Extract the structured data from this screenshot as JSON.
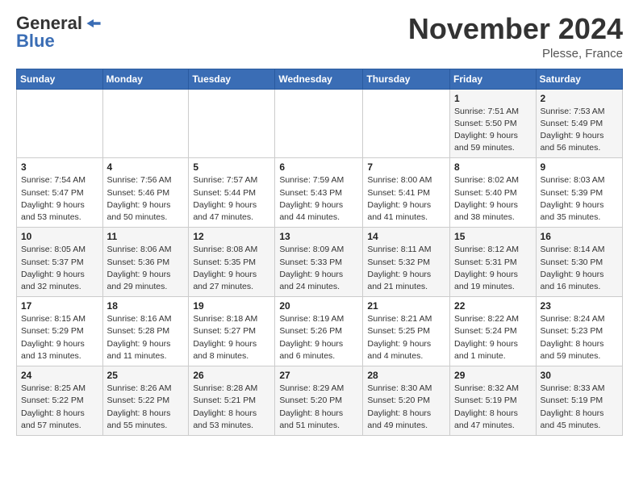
{
  "header": {
    "logo_line1": "General",
    "logo_line2": "Blue",
    "month": "November 2024",
    "location": "Plesse, France"
  },
  "weekdays": [
    "Sunday",
    "Monday",
    "Tuesday",
    "Wednesday",
    "Thursday",
    "Friday",
    "Saturday"
  ],
  "weeks": [
    [
      {
        "day": "",
        "info": ""
      },
      {
        "day": "",
        "info": ""
      },
      {
        "day": "",
        "info": ""
      },
      {
        "day": "",
        "info": ""
      },
      {
        "day": "",
        "info": ""
      },
      {
        "day": "1",
        "info": "Sunrise: 7:51 AM\nSunset: 5:50 PM\nDaylight: 9 hours and 59 minutes."
      },
      {
        "day": "2",
        "info": "Sunrise: 7:53 AM\nSunset: 5:49 PM\nDaylight: 9 hours and 56 minutes."
      }
    ],
    [
      {
        "day": "3",
        "info": "Sunrise: 7:54 AM\nSunset: 5:47 PM\nDaylight: 9 hours and 53 minutes."
      },
      {
        "day": "4",
        "info": "Sunrise: 7:56 AM\nSunset: 5:46 PM\nDaylight: 9 hours and 50 minutes."
      },
      {
        "day": "5",
        "info": "Sunrise: 7:57 AM\nSunset: 5:44 PM\nDaylight: 9 hours and 47 minutes."
      },
      {
        "day": "6",
        "info": "Sunrise: 7:59 AM\nSunset: 5:43 PM\nDaylight: 9 hours and 44 minutes."
      },
      {
        "day": "7",
        "info": "Sunrise: 8:00 AM\nSunset: 5:41 PM\nDaylight: 9 hours and 41 minutes."
      },
      {
        "day": "8",
        "info": "Sunrise: 8:02 AM\nSunset: 5:40 PM\nDaylight: 9 hours and 38 minutes."
      },
      {
        "day": "9",
        "info": "Sunrise: 8:03 AM\nSunset: 5:39 PM\nDaylight: 9 hours and 35 minutes."
      }
    ],
    [
      {
        "day": "10",
        "info": "Sunrise: 8:05 AM\nSunset: 5:37 PM\nDaylight: 9 hours and 32 minutes."
      },
      {
        "day": "11",
        "info": "Sunrise: 8:06 AM\nSunset: 5:36 PM\nDaylight: 9 hours and 29 minutes."
      },
      {
        "day": "12",
        "info": "Sunrise: 8:08 AM\nSunset: 5:35 PM\nDaylight: 9 hours and 27 minutes."
      },
      {
        "day": "13",
        "info": "Sunrise: 8:09 AM\nSunset: 5:33 PM\nDaylight: 9 hours and 24 minutes."
      },
      {
        "day": "14",
        "info": "Sunrise: 8:11 AM\nSunset: 5:32 PM\nDaylight: 9 hours and 21 minutes."
      },
      {
        "day": "15",
        "info": "Sunrise: 8:12 AM\nSunset: 5:31 PM\nDaylight: 9 hours and 19 minutes."
      },
      {
        "day": "16",
        "info": "Sunrise: 8:14 AM\nSunset: 5:30 PM\nDaylight: 9 hours and 16 minutes."
      }
    ],
    [
      {
        "day": "17",
        "info": "Sunrise: 8:15 AM\nSunset: 5:29 PM\nDaylight: 9 hours and 13 minutes."
      },
      {
        "day": "18",
        "info": "Sunrise: 8:16 AM\nSunset: 5:28 PM\nDaylight: 9 hours and 11 minutes."
      },
      {
        "day": "19",
        "info": "Sunrise: 8:18 AM\nSunset: 5:27 PM\nDaylight: 9 hours and 8 minutes."
      },
      {
        "day": "20",
        "info": "Sunrise: 8:19 AM\nSunset: 5:26 PM\nDaylight: 9 hours and 6 minutes."
      },
      {
        "day": "21",
        "info": "Sunrise: 8:21 AM\nSunset: 5:25 PM\nDaylight: 9 hours and 4 minutes."
      },
      {
        "day": "22",
        "info": "Sunrise: 8:22 AM\nSunset: 5:24 PM\nDaylight: 9 hours and 1 minute."
      },
      {
        "day": "23",
        "info": "Sunrise: 8:24 AM\nSunset: 5:23 PM\nDaylight: 8 hours and 59 minutes."
      }
    ],
    [
      {
        "day": "24",
        "info": "Sunrise: 8:25 AM\nSunset: 5:22 PM\nDaylight: 8 hours and 57 minutes."
      },
      {
        "day": "25",
        "info": "Sunrise: 8:26 AM\nSunset: 5:22 PM\nDaylight: 8 hours and 55 minutes."
      },
      {
        "day": "26",
        "info": "Sunrise: 8:28 AM\nSunset: 5:21 PM\nDaylight: 8 hours and 53 minutes."
      },
      {
        "day": "27",
        "info": "Sunrise: 8:29 AM\nSunset: 5:20 PM\nDaylight: 8 hours and 51 minutes."
      },
      {
        "day": "28",
        "info": "Sunrise: 8:30 AM\nSunset: 5:20 PM\nDaylight: 8 hours and 49 minutes."
      },
      {
        "day": "29",
        "info": "Sunrise: 8:32 AM\nSunset: 5:19 PM\nDaylight: 8 hours and 47 minutes."
      },
      {
        "day": "30",
        "info": "Sunrise: 8:33 AM\nSunset: 5:19 PM\nDaylight: 8 hours and 45 minutes."
      }
    ]
  ]
}
